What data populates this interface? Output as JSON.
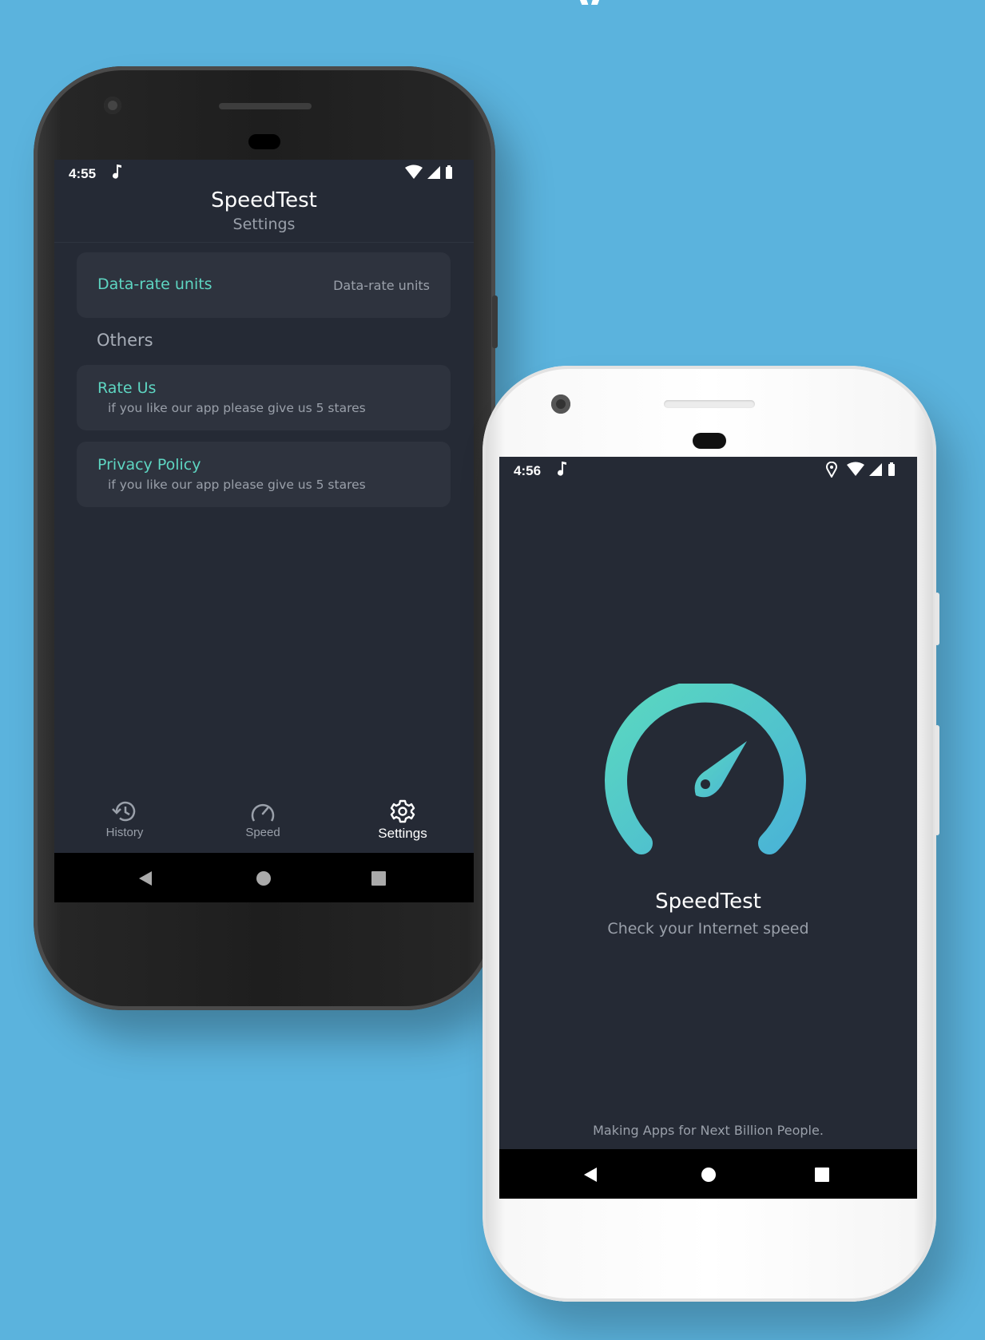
{
  "colors": {
    "background": "#5bb3dd",
    "screen": "#252a35",
    "card": "#2e333e",
    "accent": "#5ed6c2",
    "gauge_start": "#5ad8c0",
    "gauge_end": "#4ab4d6",
    "muted_text": "#9aa0aa"
  },
  "settings_phone": {
    "status": {
      "time": "4:55",
      "icons": [
        "music-note-icon",
        "wifi-icon",
        "signal-icon",
        "battery-icon"
      ]
    },
    "header": {
      "title": "SpeedTest",
      "subtitle": "Settings"
    },
    "data_rate": {
      "label": "Data-rate units",
      "value": "Data-rate units"
    },
    "others": {
      "title": "Others"
    },
    "rate_us": {
      "title": "Rate Us",
      "description": "if you like our app please give us 5 stares"
    },
    "privacy": {
      "title": "Privacy Policy",
      "description": "if you like our app please give us 5 stares"
    },
    "nav": [
      {
        "label": "History",
        "icon": "history-icon",
        "active": false
      },
      {
        "label": "Speed",
        "icon": "speedometer-icon",
        "active": false
      },
      {
        "label": "Settings",
        "icon": "gear-icon",
        "active": true
      }
    ],
    "system_nav": [
      "back-icon",
      "home-icon",
      "recents-icon"
    ]
  },
  "splash_phone": {
    "status": {
      "time": "4:56",
      "icons": [
        "music-note-icon",
        "location-icon",
        "wifi-icon",
        "signal-icon",
        "battery-icon"
      ]
    },
    "logo": "speedometer-logo",
    "title": "SpeedTest",
    "subtitle": "Check your Internet speed",
    "tagline": "Making Apps for Next Billion People.",
    "system_nav": [
      "back-icon",
      "home-icon",
      "recents-icon"
    ]
  }
}
